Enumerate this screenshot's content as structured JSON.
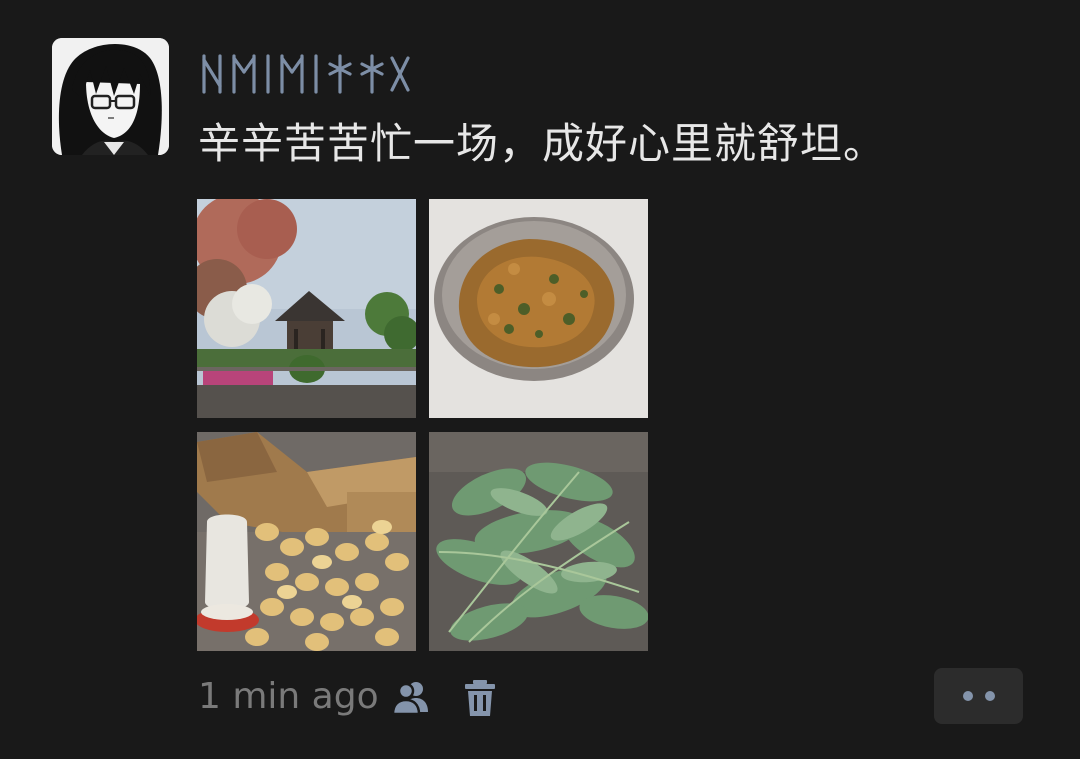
{
  "post": {
    "avatar_icon": "anime-avatar",
    "username_display": "runic-style-username",
    "text": "辛辛苦苦忙一场，成好心里就舒坦。",
    "photos": [
      {
        "name": "temple-photo"
      },
      {
        "name": "fried-greens-bowl-photo"
      },
      {
        "name": "chicks-photo"
      },
      {
        "name": "leafy-greens-photo"
      }
    ],
    "timestamp": "1 min ago",
    "visibility_icon": "people-icon",
    "delete_icon": "trash-icon",
    "more_icon": "two-dots-icon"
  },
  "colors": {
    "background": "#191919",
    "text": "#e7e7e7",
    "username": "#7d8ea6",
    "muted": "#7a7a7a",
    "icon": "#8494ab",
    "button_bg": "#2c2c2c"
  }
}
